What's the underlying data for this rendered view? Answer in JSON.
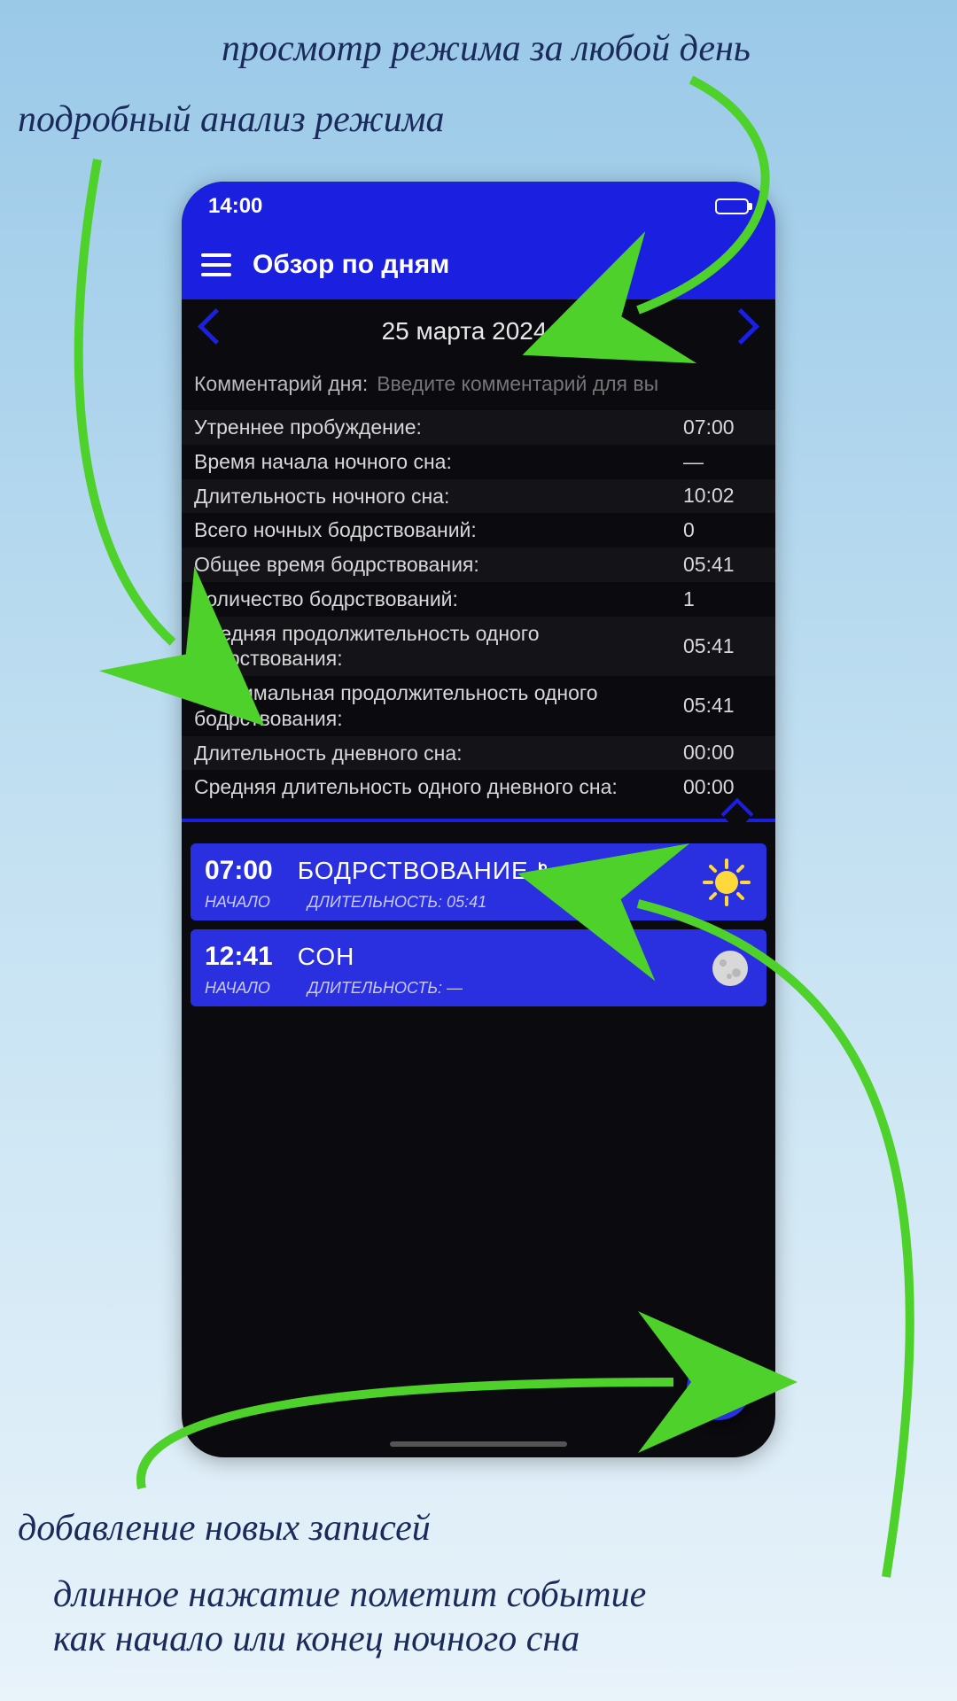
{
  "annotations": {
    "top_right": "просмотр режима за любой день",
    "top_left": "подробный анализ режима",
    "bottom_1": "добавление новых записей",
    "bottom_2_line1": "длинное нажатие пометит событие",
    "bottom_2_line2": "как начало или конец ночного сна"
  },
  "statusbar": {
    "time": "14:00"
  },
  "appbar": {
    "title": "Обзор по дням"
  },
  "datebar": {
    "date": "25 марта 2024"
  },
  "comment": {
    "label": "Комментарий дня:",
    "placeholder": "Введите комментарий для вы"
  },
  "stats": [
    {
      "label": "Утреннее пробуждение:",
      "value": "07:00"
    },
    {
      "label": "Время начала ночного сна:",
      "value": "—"
    },
    {
      "label": "Длительность ночного сна:",
      "value": "10:02"
    },
    {
      "label": "Всего ночных бодрствований:",
      "value": "0"
    },
    {
      "label": "Общее время бодрствования:",
      "value": "05:41"
    },
    {
      "label": "Количество бодрствований:",
      "value": "1"
    },
    {
      "label": "Средняя продолжительность одного бодрствования:",
      "value": "05:41"
    },
    {
      "label": "Максимальная продолжительность одного бодрствования:",
      "value": "05:41"
    },
    {
      "label": "Длительность дневного сна:",
      "value": "00:00"
    },
    {
      "label": "Средняя длительность одного дневного сна:",
      "value": "00:00"
    }
  ],
  "events": [
    {
      "time": "07:00",
      "type": "БОДРСТВОВАНИЕ",
      "start_label": "НАЧАЛО",
      "duration_label": "ДЛИТЕЛЬНОСТЬ:",
      "duration": "05:41",
      "icon": "sun",
      "bed_mark": true
    },
    {
      "time": "12:41",
      "type": "СОН",
      "start_label": "НАЧАЛО",
      "duration_label": "ДЛИТЕЛЬНОСТЬ:",
      "duration": "—",
      "icon": "moon",
      "bed_mark": false
    }
  ]
}
